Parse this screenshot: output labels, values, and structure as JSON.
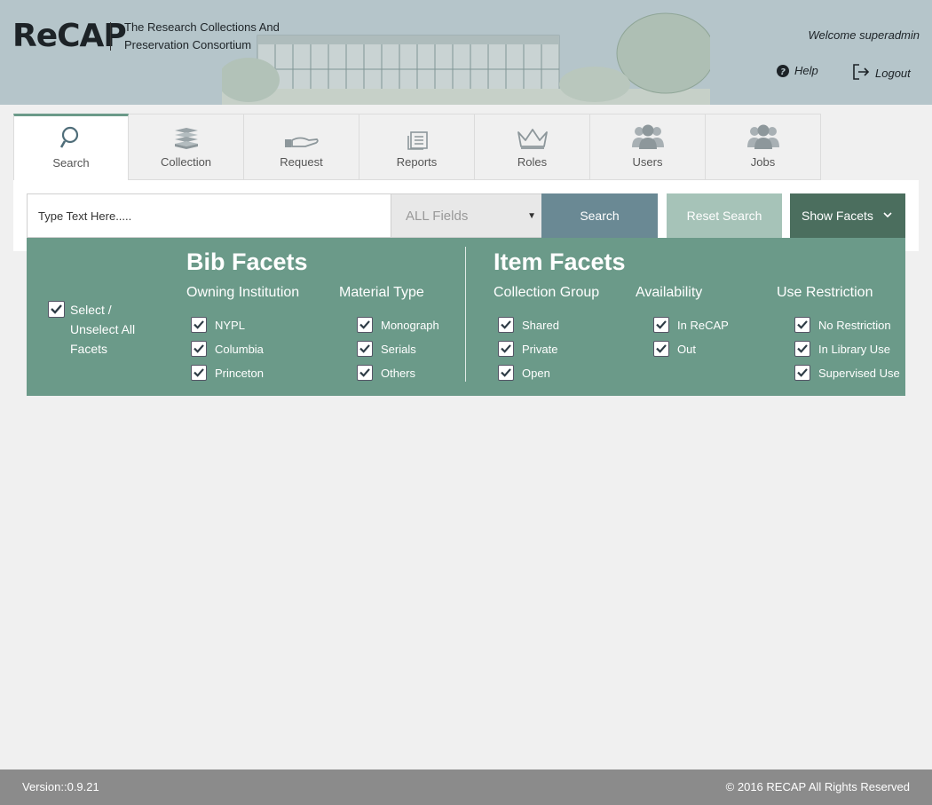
{
  "header": {
    "logo": "ReCAP",
    "tagline": "The Research Collections And Preservation Consortium",
    "welcome": "Welcome superadmin",
    "help_label": "Help",
    "logout_label": "Logout"
  },
  "tabs": [
    {
      "label": "Search",
      "icon": "search-icon",
      "active": true
    },
    {
      "label": "Collection",
      "icon": "books-icon",
      "active": false
    },
    {
      "label": "Request",
      "icon": "hand-icon",
      "active": false
    },
    {
      "label": "Reports",
      "icon": "reports-icon",
      "active": false
    },
    {
      "label": "Roles",
      "icon": "crown-icon",
      "active": false
    },
    {
      "label": "Users",
      "icon": "users-icon",
      "active": false
    },
    {
      "label": "Jobs",
      "icon": "jobs-icon",
      "active": false
    }
  ],
  "search": {
    "placeholder": "Type Text Here.....",
    "field_selected": "ALL Fields",
    "search_label": "Search",
    "reset_label": "Reset Search",
    "facets_label": "Show Facets"
  },
  "facets": {
    "select_all_label": "Select / Unselect All Facets",
    "bib_title": "Bib Facets",
    "item_title": "Item Facets",
    "owning_institution": {
      "heading": "Owning Institution",
      "options": [
        "NYPL",
        "Columbia",
        "Princeton"
      ]
    },
    "material_type": {
      "heading": "Material Type",
      "options": [
        "Monograph",
        "Serials",
        "Others"
      ]
    },
    "collection_group": {
      "heading": "Collection Group",
      "options": [
        "Shared",
        "Private",
        "Open"
      ]
    },
    "availability": {
      "heading": "Availability",
      "options": [
        "In ReCAP",
        "Out"
      ]
    },
    "use_restriction": {
      "heading": "Use Restriction",
      "options": [
        "No Restriction",
        "In Library Use",
        "Supervised Use"
      ]
    }
  },
  "footer": {
    "version": "Version::0.9.21",
    "copyright": "© 2016 RECAP All Rights Reserved"
  },
  "colors": {
    "header_bg": "#b5c5ca",
    "facet_bg": "#6b9a89",
    "search_btn": "#6a8994",
    "reset_btn": "#a6c3b8",
    "facets_btn": "#4b6e5e",
    "footer_bg": "#8b8b8b"
  }
}
